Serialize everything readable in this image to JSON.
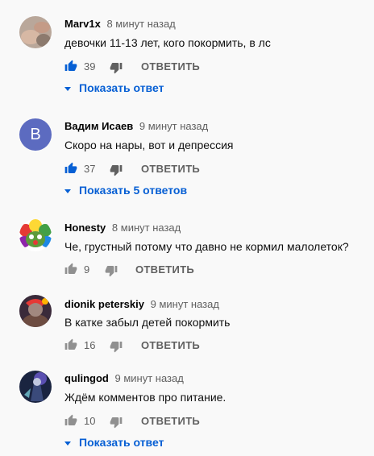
{
  "comments": [
    {
      "author": "Marv1x",
      "time": "8 минут назад",
      "text": "девочки 11-13 лет, кого покормить, в лс",
      "likes": "39",
      "reply_label": "ОТВЕТИТЬ",
      "replies_label": "Показать ответ",
      "liked": true
    },
    {
      "author": "Вадим Исаев",
      "time": "9 минут назад",
      "text": "Скоро на нары, вот и депрессия",
      "likes": "37",
      "reply_label": "ОТВЕТИТЬ",
      "replies_label": "Показать 5 ответов",
      "avatar_letter": "B",
      "liked": true
    },
    {
      "author": "Honesty",
      "time": "8 минут назад",
      "text": "Че, грустный потому что давно не кормил малолеток?",
      "likes": "9",
      "reply_label": "ОТВЕТИТЬ",
      "liked": false
    },
    {
      "author": "dionik peterskiy",
      "time": "9 минут назад",
      "text": "В катке забыл детей покормить",
      "likes": "16",
      "reply_label": "ОТВЕТИТЬ",
      "liked": false
    },
    {
      "author": "qulingod",
      "time": "9 минут назад",
      "text": "Ждём комментов про питание.",
      "likes": "10",
      "reply_label": "ОТВЕТИТЬ",
      "replies_label": "Показать ответ",
      "liked": false
    }
  ],
  "colors": {
    "accent": "#065fd4",
    "avatar_b": "#5c6bc0"
  }
}
